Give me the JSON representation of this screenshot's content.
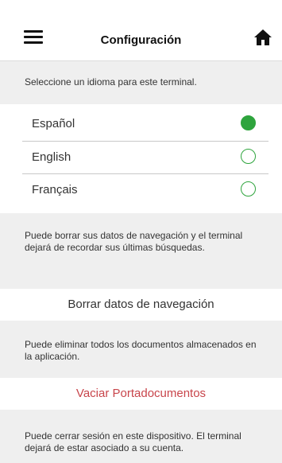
{
  "header": {
    "title": "Configuración",
    "menu_icon": "hamburger-menu-icon",
    "home_icon": "home-icon"
  },
  "language": {
    "note": "Seleccione un idioma para este terminal.",
    "options": [
      {
        "label": "Español",
        "selected": true
      },
      {
        "label": "English",
        "selected": false
      },
      {
        "label": "Français",
        "selected": false
      }
    ]
  },
  "browsing": {
    "note": "Puede borrar sus datos de navegación y el terminal dejará de recordar sus últimas búsquedas.",
    "action_label": "Borrar datos de navegación"
  },
  "documents": {
    "note": "Puede eliminar todos los documentos almacenados en la aplicación.",
    "action_label": "Vaciar Portadocumentos"
  },
  "session": {
    "note": "Puede cerrar sesión en este dispositivo. El terminal dejará de estar asociado a su cuenta."
  },
  "colors": {
    "accent_green": "#2ea43d",
    "danger_red": "#c8454b",
    "background": "#efefef"
  }
}
